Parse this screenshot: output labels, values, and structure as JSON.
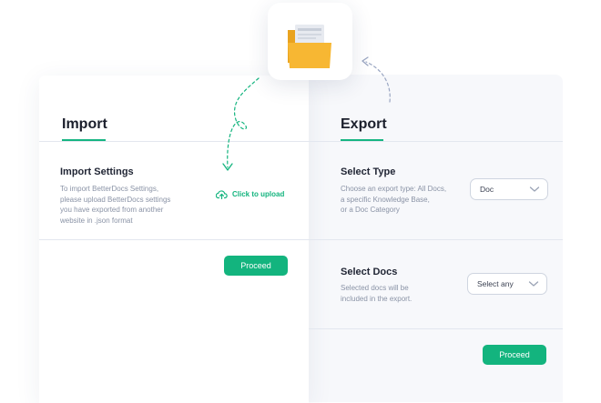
{
  "import": {
    "tab": "Import",
    "settings_label": "Import Settings",
    "desc_lines": [
      "To import BetterDocs Settings,",
      "please upload BetterDocs settings",
      "you have exported from another",
      "website in .json format"
    ],
    "upload_label": "Click to upload",
    "proceed": "Proceed"
  },
  "export": {
    "tab": "Export",
    "select_type": {
      "label": "Select Type",
      "desc_lines": [
        "Choose an export type: All Docs,",
        "a specific Knowledge Base,",
        "or a Doc Category"
      ],
      "value": "Doc"
    },
    "select_docs": {
      "label": "Select Docs",
      "desc_lines": [
        "Selected docs will be",
        "included in the export."
      ],
      "placeholder": "Select any"
    },
    "proceed": "Proceed"
  },
  "icons": {
    "folder": "folder-document-icon",
    "upload": "cloud-upload-icon",
    "chevron": "chevron-down-icon"
  },
  "colors": {
    "accent": "#13b47e",
    "folder": "#f7b733"
  }
}
